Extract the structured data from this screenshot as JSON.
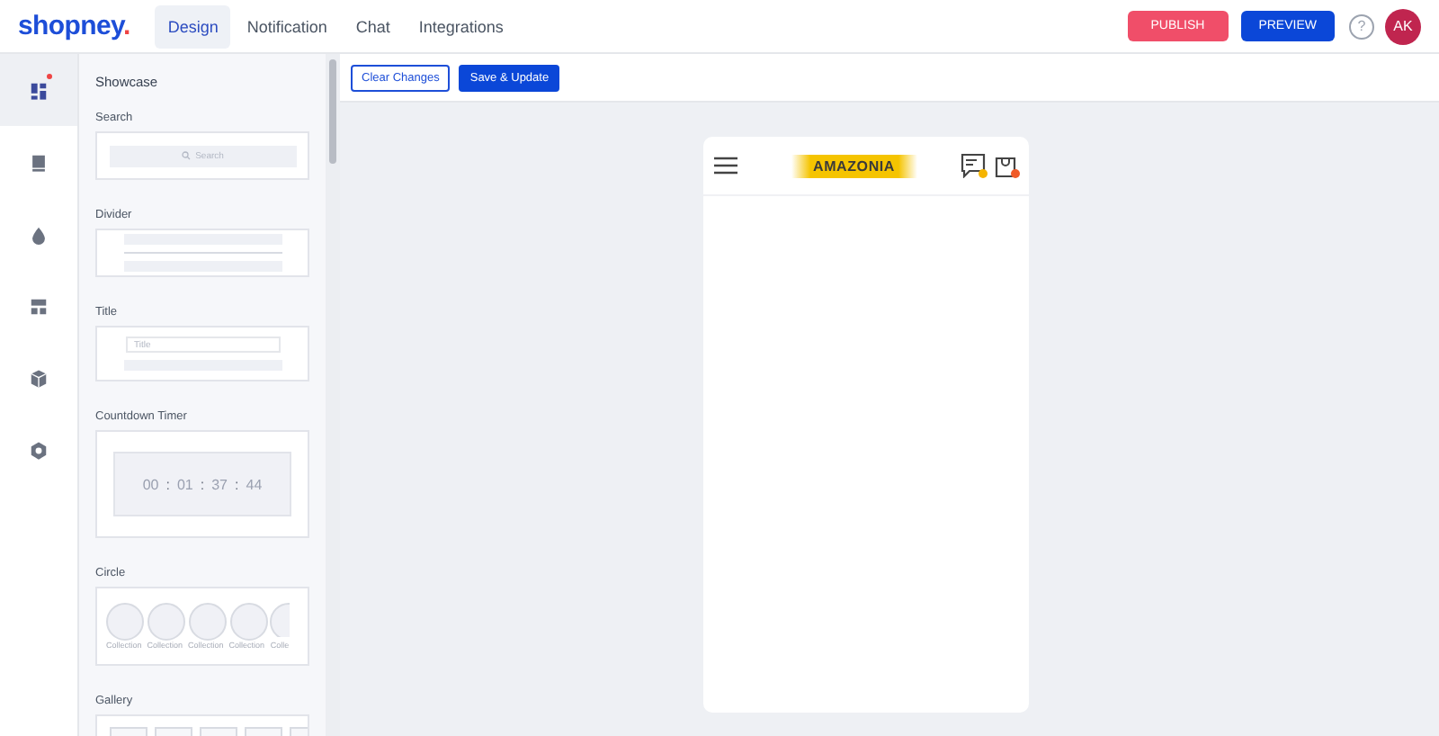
{
  "brand": {
    "name": "shopney",
    "dot": "."
  },
  "nav_tabs": [
    {
      "label": "Design",
      "selected": true
    },
    {
      "label": "Notification",
      "selected": false
    },
    {
      "label": "Chat",
      "selected": false
    },
    {
      "label": "Integrations",
      "selected": false
    }
  ],
  "header_actions": {
    "publish": "PUBLISH",
    "preview": "PREVIEW",
    "help": "?",
    "avatar": "AK"
  },
  "rail": [
    {
      "kind": "dashboard",
      "selected": true,
      "badge": true
    },
    {
      "kind": "page",
      "selected": false,
      "badge": false
    },
    {
      "kind": "drop",
      "selected": false,
      "badge": false
    },
    {
      "kind": "layout",
      "selected": false,
      "badge": false
    },
    {
      "kind": "box",
      "selected": false,
      "badge": false
    },
    {
      "kind": "hexagon",
      "selected": false,
      "badge": false
    }
  ],
  "sidebar": {
    "title": "Showcase",
    "widgets": [
      {
        "kind": "search",
        "label": "Search",
        "placeholder": "Search"
      },
      {
        "kind": "divider",
        "label": "Divider"
      },
      {
        "kind": "title",
        "label": "Title",
        "placeholder": "Title"
      },
      {
        "kind": "countdown",
        "label": "Countdown Timer",
        "digits": [
          "00",
          "01",
          "37",
          "44"
        ],
        "separator": ":"
      },
      {
        "kind": "circle",
        "label": "Circle",
        "items": [
          "Collection",
          "Collection",
          "Collection",
          "Collection",
          "Colle"
        ]
      },
      {
        "kind": "gallery",
        "label": "Gallery"
      }
    ]
  },
  "toolbar": {
    "clear": "Clear Changes",
    "save": "Save & Update"
  },
  "preview": {
    "logo": "AMAZONIA",
    "chat_badge": true,
    "cart_badge": true
  }
}
